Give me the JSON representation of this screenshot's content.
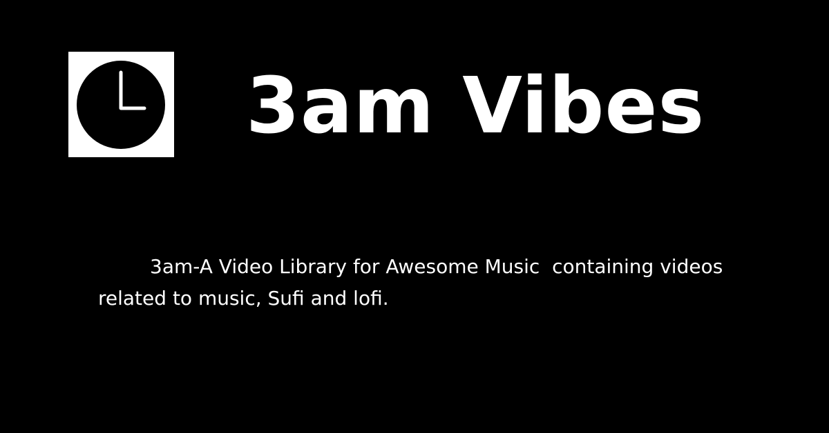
{
  "header": {
    "title": "3am Vibes",
    "logo_icon": "clock-icon"
  },
  "main": {
    "description": "3am-A Video Library for Awesome Music  containing videos related to music, Sufi and lofi."
  },
  "colors": {
    "background": "#000000",
    "text": "#ffffff",
    "logo_background": "#ffffff",
    "logo_clock": "#000000"
  }
}
